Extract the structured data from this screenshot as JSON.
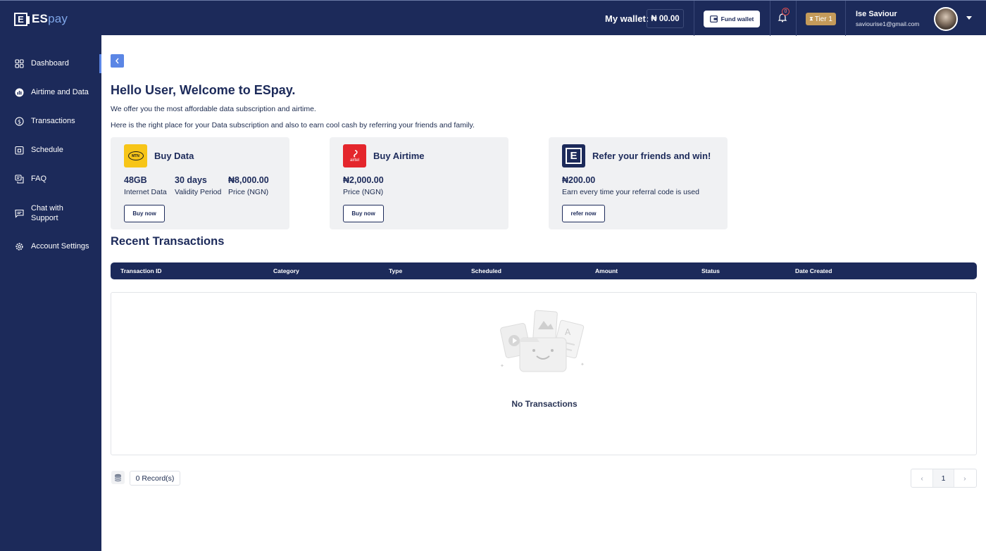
{
  "header": {
    "logo_letter": "E",
    "logo_es": "ES",
    "logo_pay": "pay",
    "wallet_label": "My wallet:",
    "wallet_amount": "₦ 00.00",
    "fund_wallet_label": "Fund wallet",
    "notification_count": "0",
    "tier_label": "Tier 1",
    "user_name": "Ise Saviour",
    "user_email": "saviourise1@gmail.com",
    "accent_color": "#1c2a5a"
  },
  "sidebar": {
    "items": [
      {
        "label": "Dashboard",
        "icon": "grid-icon"
      },
      {
        "label": "Airtime and Data",
        "icon": "signal-icon"
      },
      {
        "label": "Transactions",
        "icon": "dollar-icon"
      },
      {
        "label": "Schedule",
        "icon": "calendar-icon"
      },
      {
        "label": "FAQ",
        "icon": "faq-icon"
      },
      {
        "label": "Chat with Support",
        "icon": "chat-icon"
      },
      {
        "label": "Account Settings",
        "icon": "gear-icon"
      }
    ]
  },
  "main": {
    "greeting": "Hello User, Welcome to ESpay.",
    "intro_line1": "We offer you the most affordable data subscription and airtime.",
    "intro_line2": "Here is the right place for your Data subscription and also to earn cool cash by referring your friends and family.",
    "cards": {
      "data": {
        "title": "Buy Data",
        "logo_text": "MTN",
        "stat1_value": "48GB",
        "stat1_label": "Internet Data",
        "stat2_value": "30 days",
        "stat2_label": "Validity Period",
        "stat3_value": "₦8,000.00",
        "stat3_label": "Price (NGN)",
        "button": "Buy now"
      },
      "airtime": {
        "title": "Buy Airtime",
        "logo_text": "airtel",
        "stat1_value": "₦2,000.00",
        "stat1_label": "Price (NGN)",
        "button": "Buy now"
      },
      "refer": {
        "title": "Refer your friends and win!",
        "stat1_value": "₦200.00",
        "stat1_label": "Earn every time your referral code is used",
        "button": "refer now"
      }
    },
    "recent_title": "Recent Transactions",
    "table": {
      "columns": [
        "Transaction ID",
        "Category",
        "Type",
        "Scheduled",
        "Amount",
        "Status",
        "Date Created"
      ],
      "empty_text": "No Transactions"
    },
    "footer": {
      "records": "0 Record(s)",
      "pager_prev": "‹",
      "current_page": "1",
      "pager_next": "›"
    }
  }
}
